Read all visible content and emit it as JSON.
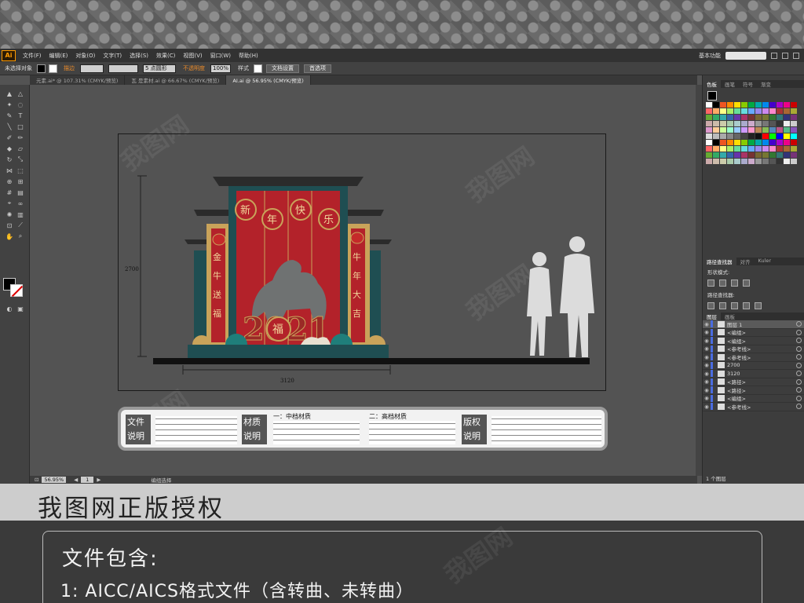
{
  "menubar": {
    "logo": "Ai",
    "items": [
      "文件(F)",
      "编辑(E)",
      "对象(O)",
      "文字(T)",
      "选择(S)",
      "效果(C)",
      "视图(V)",
      "窗口(W)",
      "帮助(H)"
    ],
    "workspace": "基本功能"
  },
  "control_bar": {
    "selection_label": "未选择对象",
    "stroke_label": "描边",
    "stroke_width": "5 点圆形",
    "opacity_label": "不透明度",
    "opacity_value": "100%",
    "style_label": "样式",
    "doc_settings_label": "文档设置",
    "prefs_label": "首选项"
  },
  "tabs": [
    "元素.ai* @ 107.31% (CMYK/预览)",
    "瓦 是素材.ai @ 66.67% (CMYK/预览)",
    "AI.ai @ 56.95% (CMYK/预览)"
  ],
  "artwork": {
    "height_dim": "2700",
    "width_dim": "3120",
    "title_chars": [
      "新",
      "年",
      "快",
      "乐"
    ],
    "left_couplet": [
      "金",
      "牛",
      "送",
      "福"
    ],
    "right_couplet": [
      "牛",
      "年",
      "大",
      "吉"
    ],
    "fu_char": "福",
    "year_text": "2021",
    "colors": {
      "red": "#b3222a",
      "teal": "#1f4e52",
      "gold": "#c9a35a",
      "dark": "#2b2b2b"
    }
  },
  "info_strip": {
    "section1_title": "文件说明",
    "section2_title": "材质说明",
    "mid_grade": "一：中档材质",
    "high_grade": "二：高档材质",
    "section3_title": "版权说明"
  },
  "status": {
    "zoom": "56.95%",
    "page": "1",
    "tool_label": "编组选择"
  },
  "panels": {
    "swatch_tabs": [
      "色板",
      "画笔",
      "符号",
      "渐变"
    ],
    "pathfinder_tabs": [
      "路径查找器",
      "对齐",
      "Kuler"
    ],
    "shape_modes_label": "形状模式:",
    "pathfinder_label": "路径查找器:",
    "layer_tabs": [
      "图层",
      "画板"
    ],
    "layers": [
      {
        "name": "图层 1",
        "selected": true
      },
      {
        "name": "<编组>",
        "selected": false
      },
      {
        "name": "<编组>",
        "selected": false
      },
      {
        "name": "<参考线>",
        "selected": false
      },
      {
        "name": "<参考线>",
        "selected": false
      },
      {
        "name": "2700",
        "selected": false
      },
      {
        "name": "3120",
        "selected": false
      },
      {
        "name": "<路径>",
        "selected": false
      },
      {
        "name": "<路径>",
        "selected": false
      },
      {
        "name": "<编组>",
        "selected": false
      },
      {
        "name": "<参考线>",
        "selected": false
      }
    ],
    "layer_count": "1 个图层"
  },
  "banner": {
    "title": "我图网正版授权",
    "file_contains": "文件包含:",
    "file_format": "1: AICC/AICS格式文件（含转曲、未转曲）"
  },
  "watermark": "我图网"
}
